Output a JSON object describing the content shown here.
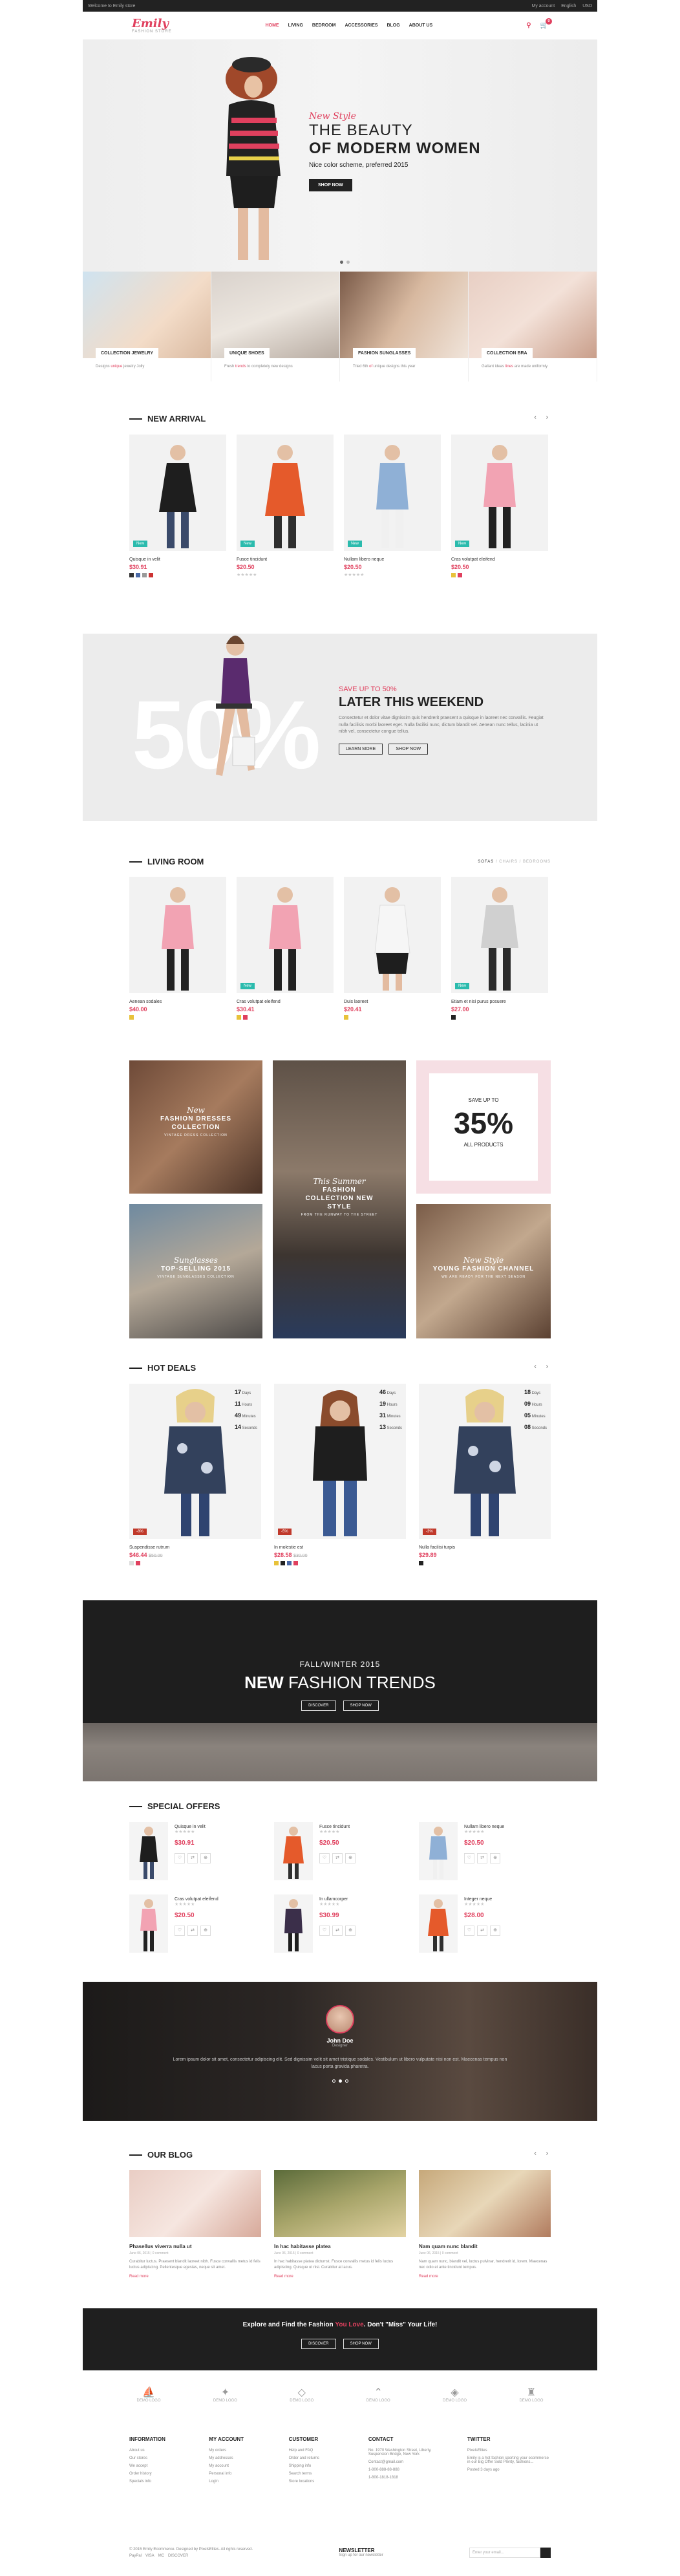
{
  "topbar": {
    "left": "Welcome to Emily store",
    "account": "My account",
    "language": "English",
    "currency": "USD"
  },
  "brand": {
    "name": "Emily",
    "tagline": "FASHION STORE",
    "accent": "#e0405e"
  },
  "nav": {
    "items": [
      "HOME",
      "LIVING",
      "BEDROOM",
      "ACCESSORIES",
      "BLOG",
      "ABOUT US"
    ],
    "cart_count": "0"
  },
  "hero": {
    "script": "New Style",
    "line1": "THE BEAUTY",
    "line2": "OF MODERM WOMEN",
    "sub": "Nice color scheme, preferred 2015",
    "button": "SHOP NOW"
  },
  "categories": [
    {
      "label": "COLLECTION JEWELRY",
      "cap_a": "Designs ",
      "cap_b": "unique",
      "cap_c": " jewelry Jolly"
    },
    {
      "label": "UNIQUE SHOES",
      "cap_a": "Fresh ",
      "cap_b": "trends",
      "cap_c": " to completely new designs"
    },
    {
      "label": "FASHION SUNGLASSES",
      "cap_a": "Tried 6th ",
      "cap_b": "of",
      "cap_c": " unique designs this year"
    },
    {
      "label": "COLLECTION BRA",
      "cap_a": "Gallant ideas ",
      "cap_b": "lines",
      "cap_c": " are made uniformly"
    }
  ],
  "new_arrival": {
    "title": "NEW ARRIVAL",
    "items": [
      {
        "name": "Quisque in velit",
        "price": "$30.91",
        "badge": "New"
      },
      {
        "name": "Fusce tincidunt",
        "price": "$20.50",
        "badge": "New"
      },
      {
        "name": "Nullam libero neque",
        "price": "$20.50",
        "badge": "New"
      },
      {
        "name": "Cras volutpat eleifend",
        "price": "$20.50",
        "badge": "New"
      }
    ]
  },
  "promo": {
    "big": "50%",
    "sub": "SAVE UP TO 50%",
    "title": "LATER THIS WEEKEND",
    "body": "Consectetur et dolor vitae dignissim quis hendrerit praesent a quisque in laoreet nec convallis. Feugiat nulla facilisis morbi laoreet eget. Nulla facilisi nunc, dictum blandit vel. Aenean nunc tellus, lacinia ut nibh vel, consectetur congue tellus.",
    "btn1": "LEARN MORE",
    "btn2": "SHOP NOW"
  },
  "living": {
    "title": "LIVING ROOM",
    "tabs": [
      "SOFAS",
      "CHAIRS",
      "BEDROOMS"
    ],
    "items": [
      {
        "name": "Aenean sodales",
        "price": "$40.00"
      },
      {
        "name": "Cras volutpat eleifend",
        "price": "$30.41",
        "badge": "New"
      },
      {
        "name": "Duis laoreet",
        "price": "$20.41"
      },
      {
        "name": "Etiam et nisi purus posuere",
        "price": "$27.00",
        "badge": "New"
      }
    ]
  },
  "banners": [
    {
      "script": "New",
      "title": "FASHION DRESSES COLLECTION",
      "small": "VINTAGE DRESS COLLECTION"
    },
    {
      "script": "This Summer",
      "title": "FASHION COLLECTION NEW STYLE",
      "small": "FROM THE RUNWAY TO THE STREET"
    },
    {
      "top": "SAVE UP TO",
      "big": "35%",
      "bottom": "ALL PRODUCTS"
    },
    {
      "script": "Sunglasses",
      "title": "TOP-SELLING 2015",
      "small": "VINTAGE SUNGLASSES COLLECTION"
    },
    {
      "script": "New Style",
      "title": "YOUNG FASHION CHANNEL",
      "small": "WE ARE READY FOR THE NEXT SEASON"
    }
  ],
  "hot_deals": {
    "title": "HOT DEALS",
    "units": [
      "Days",
      "Hours",
      "Minutes",
      "Seconds"
    ],
    "items": [
      {
        "name": "Suspendisse rutrum",
        "price": "$46.44",
        "old": "$50.00",
        "count": [
          "17",
          "11",
          "49",
          "14"
        ]
      },
      {
        "name": "In molestie est",
        "price": "$28.58",
        "old": "$30.00",
        "count": [
          "46",
          "19",
          "31",
          "13"
        ]
      },
      {
        "name": "Nulla facilisi turpis",
        "price": "$29.89",
        "old": "",
        "count": [
          "18",
          "09",
          "05",
          "08"
        ]
      }
    ]
  },
  "fall": {
    "line1": "FALL/WINTER 2015",
    "bold": "NEW",
    "rest": " FASHION TRENDS",
    "btn1": "DISCOVER",
    "btn2": "SHOP NOW"
  },
  "special": {
    "title": "SPECIAL OFFERS",
    "items": [
      {
        "name": "Quisque in velit",
        "price": "$30.91"
      },
      {
        "name": "Fusce tincidunt",
        "price": "$20.50"
      },
      {
        "name": "Nullam libero neque",
        "price": "$20.50"
      },
      {
        "name": "Cras volutpat eleifend",
        "price": "$20.50"
      },
      {
        "name": "In ullamcorper",
        "price": "$30.99"
      },
      {
        "name": "Integer neque",
        "price": "$28.00"
      }
    ]
  },
  "testimonial": {
    "name": "John Doe",
    "role": "Designer",
    "quote": "Lorem ipsum dolor sit amet, consectetur adipiscing elit. Sed dignissim velit sit amet tristique sodales. Vestibulum ut libero vulputate nisi non est. Maecenas tempus non lacus porta gravida pharetra."
  },
  "blog": {
    "title": "OUR BLOG",
    "items": [
      {
        "title": "Phasellus viverra nulla ut",
        "meta": "June 06, 2015 | 0 comment",
        "body": "Curabitur luctus. Praesent blandit laoreet nibh. Fusce convallis metus id felis luctus adipiscing. Pellentesque egestas, neque sit amet.",
        "more": "Read more"
      },
      {
        "title": "In hac habitasse platea",
        "meta": "June 06, 2015 | 0 comment",
        "body": "In hac habitasse platea dictumst. Fusce convallis metus id felis luctus adipiscing. Quisque ut nisi. Curabitur at lacus.",
        "more": "Read more"
      },
      {
        "title": "Nam quam nunc blandit",
        "meta": "June 06, 2015 | 0 comment",
        "body": "Nam quam nunc, blandit vel, luctus pulvinar, hendrerit id, lorem. Maecenas nec odio et ante tincidunt tempus.",
        "more": "Read more"
      }
    ]
  },
  "explore": {
    "a": "Explore and Find the Fashion ",
    "b": "You Love",
    "c": ". Don't \"Miss\" Your Life!",
    "btn1": "DISCOVER",
    "btn2": "SHOP NOW"
  },
  "logos": [
    "DEMO LOGO",
    "DEMO LOGO",
    "DEMO LOGO",
    "DEMO LOGO",
    "DEMO LOGO",
    "DEMO LOGO"
  ],
  "footer": {
    "info": {
      "title": "INFORMATION",
      "items": [
        "About us",
        "Our stores",
        "We accept",
        "Order history",
        "Specials info"
      ]
    },
    "account": {
      "title": "MY ACCOUNT",
      "items": [
        "My orders",
        "My addresses",
        "My account",
        "Personal info",
        "Login"
      ]
    },
    "customer": {
      "title": "CUSTOMER",
      "items": [
        "Help and FAQ",
        "Order and returns",
        "Shipping info",
        "Search terms",
        "Store locations"
      ]
    },
    "contact": {
      "title": "CONTACT",
      "items": [
        "No. 1970 Washington Street, Liberty, Suspension Bridge, New York",
        "Contact@gmail.com",
        "1-800-888-88-888",
        "1-800-1818-1818"
      ]
    },
    "twitter": {
      "title": "TWITTER",
      "handle": "PixelsElites",
      "body": "Emily is a hot fashion sporting your ecommerce in our Big Offer Sold Plenty, fashions...",
      "when": "Posted 3 days ago"
    }
  },
  "bottom": {
    "copy": "© 2015 Emily Ecommerce. Designed by PixelsElites. All rights reserved.",
    "newsletter": "NEWSLETTER",
    "nl_sub": "Sign up for our newsletter",
    "nl_placeholder": "Enter your email...",
    "pay": [
      "PayPal",
      "VISA",
      "MC",
      "DISCOVER"
    ]
  }
}
